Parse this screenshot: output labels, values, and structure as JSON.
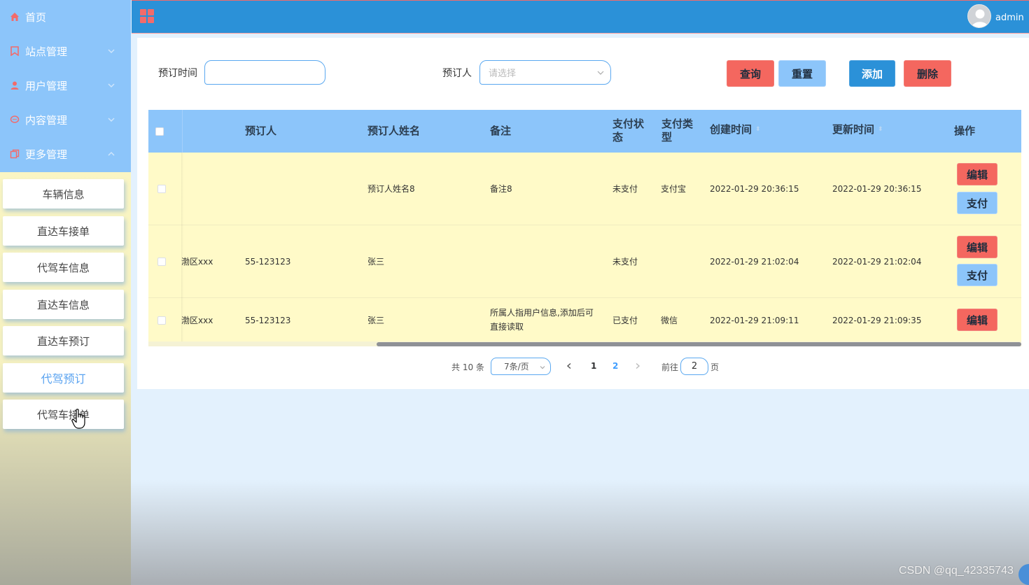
{
  "header": {
    "user_name": "admin"
  },
  "sidebar": {
    "menu": [
      {
        "label": "首页",
        "icon": "home-icon",
        "has_chevron": false
      },
      {
        "label": "站点管理",
        "icon": "bookmark-icon",
        "has_chevron": true,
        "expanded": false
      },
      {
        "label": "用户管理",
        "icon": "user-icon",
        "has_chevron": true,
        "expanded": false
      },
      {
        "label": "内容管理",
        "icon": "chat-icon",
        "has_chevron": true,
        "expanded": false
      },
      {
        "label": "更多管理",
        "icon": "copy-icon",
        "has_chevron": true,
        "expanded": true
      }
    ],
    "submenu": [
      {
        "label": "车辆信息"
      },
      {
        "label": "直达车接单"
      },
      {
        "label": "代驾车信息"
      },
      {
        "label": "直达车信息"
      },
      {
        "label": "直达车预订"
      },
      {
        "label": "代驾预订",
        "active": true
      },
      {
        "label": "代驾车接单"
      }
    ]
  },
  "filters": {
    "time_label": "预订时间",
    "time_value": "",
    "person_label": "预订人",
    "person_placeholder": "请选择"
  },
  "actions": {
    "search": "查询",
    "reset": "重置",
    "add": "添加",
    "delete": "删除"
  },
  "table": {
    "columns": {
      "person": "预订人",
      "person_name": "预订人姓名",
      "remark": "备注",
      "pay_status": "支付状态",
      "pay_type": "支付类型",
      "created": "创建时间",
      "updated": "更新时间",
      "ops": "操作"
    },
    "op_edit": "编辑",
    "op_pay": "支付",
    "rows": [
      {
        "address": "",
        "person": "",
        "person_name": "预订人姓名8",
        "remark": "备注8",
        "pay_status": "未支付",
        "pay_type": "支付宝",
        "created": "2022-01-29 20:36:15",
        "updated": "2022-01-29 20:36:15",
        "show_pay": true
      },
      {
        "address": "渤区xxx",
        "person": "55-123123",
        "person_name": "张三",
        "remark": "",
        "pay_status": "未支付",
        "pay_type": "",
        "created": "2022-01-29 21:02:04",
        "updated": "2022-01-29 21:02:04",
        "show_pay": true
      },
      {
        "address": "渤区xxx",
        "person": "55-123123",
        "person_name": "张三",
        "remark": "所属人指用户信息,添加后可直接读取",
        "pay_status": "已支付",
        "pay_type": "微信",
        "created": "2022-01-29 21:09:11",
        "updated": "2022-01-29 21:09:35",
        "show_pay": false
      }
    ]
  },
  "pagination": {
    "total": "共 10 条",
    "page_size": "7条/页",
    "pages": [
      "1",
      "2"
    ],
    "current_page": "2",
    "goto_prefix": "前往",
    "goto_value": "2",
    "goto_suffix": "页"
  },
  "watermark": "CSDN @qq_42335743",
  "colors": {
    "header": "#2b91d8",
    "sidebar_menu": "#8cc5fa",
    "table_body": "#fffac8",
    "danger": "#f4675f",
    "primary": "#2b91d8",
    "light_primary": "#8cc5fa"
  }
}
